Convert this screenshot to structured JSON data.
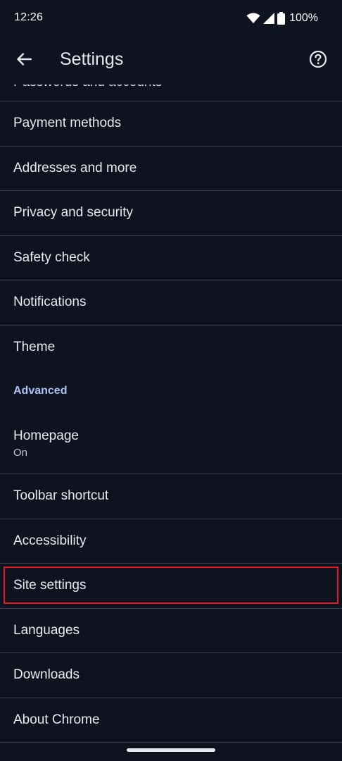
{
  "status_bar": {
    "time": "12:26",
    "battery": "100%"
  },
  "app_bar": {
    "title": "Settings"
  },
  "list": {
    "partial_item": "Passwords and accounts",
    "items_top": [
      {
        "label": "Payment methods"
      },
      {
        "label": "Addresses and more"
      },
      {
        "label": "Privacy and security"
      },
      {
        "label": "Safety check"
      },
      {
        "label": "Notifications"
      },
      {
        "label": "Theme"
      }
    ],
    "section_header": "Advanced",
    "homepage": {
      "label": "Homepage",
      "sub": "On"
    },
    "items_bottom": [
      {
        "label": "Toolbar shortcut"
      },
      {
        "label": "Accessibility"
      },
      {
        "label": "Site settings",
        "highlighted": true
      },
      {
        "label": "Languages"
      },
      {
        "label": "Downloads"
      },
      {
        "label": "About Chrome"
      }
    ]
  },
  "colors": {
    "background": "#0f1320",
    "divider": "#3a3f4d",
    "accent": "#a9c3f5",
    "highlight": "#e01b24"
  }
}
